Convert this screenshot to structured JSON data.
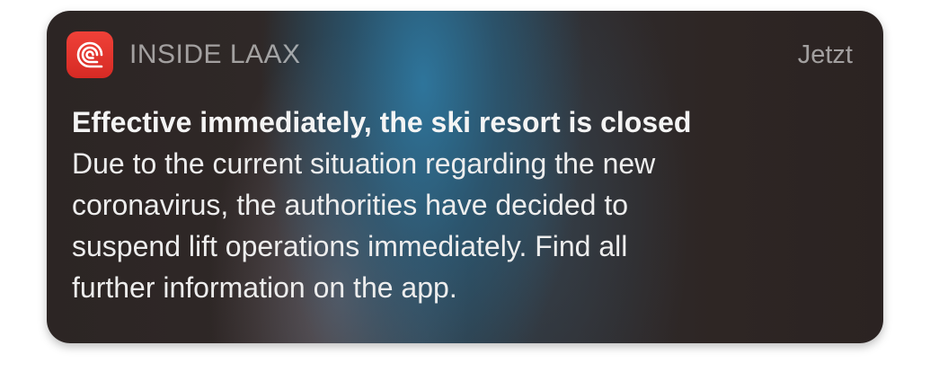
{
  "notification": {
    "app_name": "INSIDE LAAX",
    "app_icon": "laax-spiral-icon",
    "timestamp": "Jetzt",
    "title": "Effective immediately, the ski resort is closed",
    "body": "Due to the current situation regarding the new\ncoronavirus, the authorities have decided to\nsuspend lift operations immediately. Find all\nfurther information on the app.",
    "icon_color": "#e8352e"
  }
}
